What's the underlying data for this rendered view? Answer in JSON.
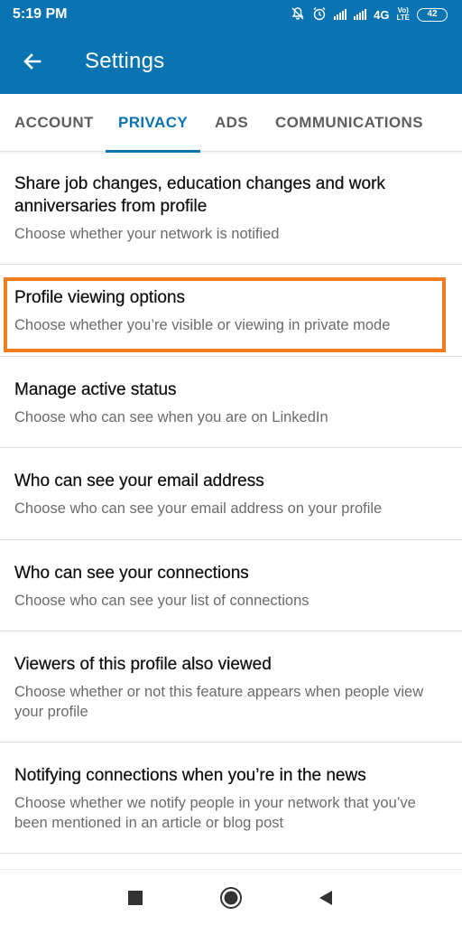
{
  "status_bar": {
    "time": "5:19 PM",
    "network": "4G",
    "volte_top": "Vo)",
    "volte_bottom": "LTE",
    "battery": "42",
    "icons": [
      "mute-icon",
      "alarm-icon",
      "signal-icon",
      "signal-icon"
    ]
  },
  "header": {
    "title": "Settings",
    "back_icon": "back-arrow-icon"
  },
  "tabs": [
    {
      "label": "ACCOUNT",
      "active": false
    },
    {
      "label": "PRIVACY",
      "active": true
    },
    {
      "label": "ADS",
      "active": false
    },
    {
      "label": "COMMUNICATIONS",
      "active": false
    }
  ],
  "settings": [
    {
      "title": "Share job changes, education changes and work anniversaries from profile",
      "subtitle": "Choose whether your network is notified"
    },
    {
      "title": "Profile viewing options",
      "subtitle": "Choose whether you’re visible or viewing in private mode",
      "highlighted": true
    },
    {
      "title": "Manage active status",
      "subtitle": "Choose who can see when you are on LinkedIn"
    },
    {
      "title": "Who can see your email address",
      "subtitle": "Choose who can see your email address on your profile"
    },
    {
      "title": "Who can see your connections",
      "subtitle": "Choose who can see your list of connections"
    },
    {
      "title": "Viewers of this profile also viewed",
      "subtitle": "Choose whether or not this feature appears when people view your profile"
    },
    {
      "title": "Notifying connections when you’re in the news",
      "subtitle": "Choose whether we notify people in your network that you’ve been mentioned in an article or blog post"
    }
  ],
  "nav": {
    "recents_icon": "square-icon",
    "home_icon": "circle-icon",
    "back_icon": "triangle-back-icon"
  },
  "colors": {
    "primary": "#0a73b1",
    "highlight": "#f47c20",
    "subtitle": "#6b6b6b"
  }
}
